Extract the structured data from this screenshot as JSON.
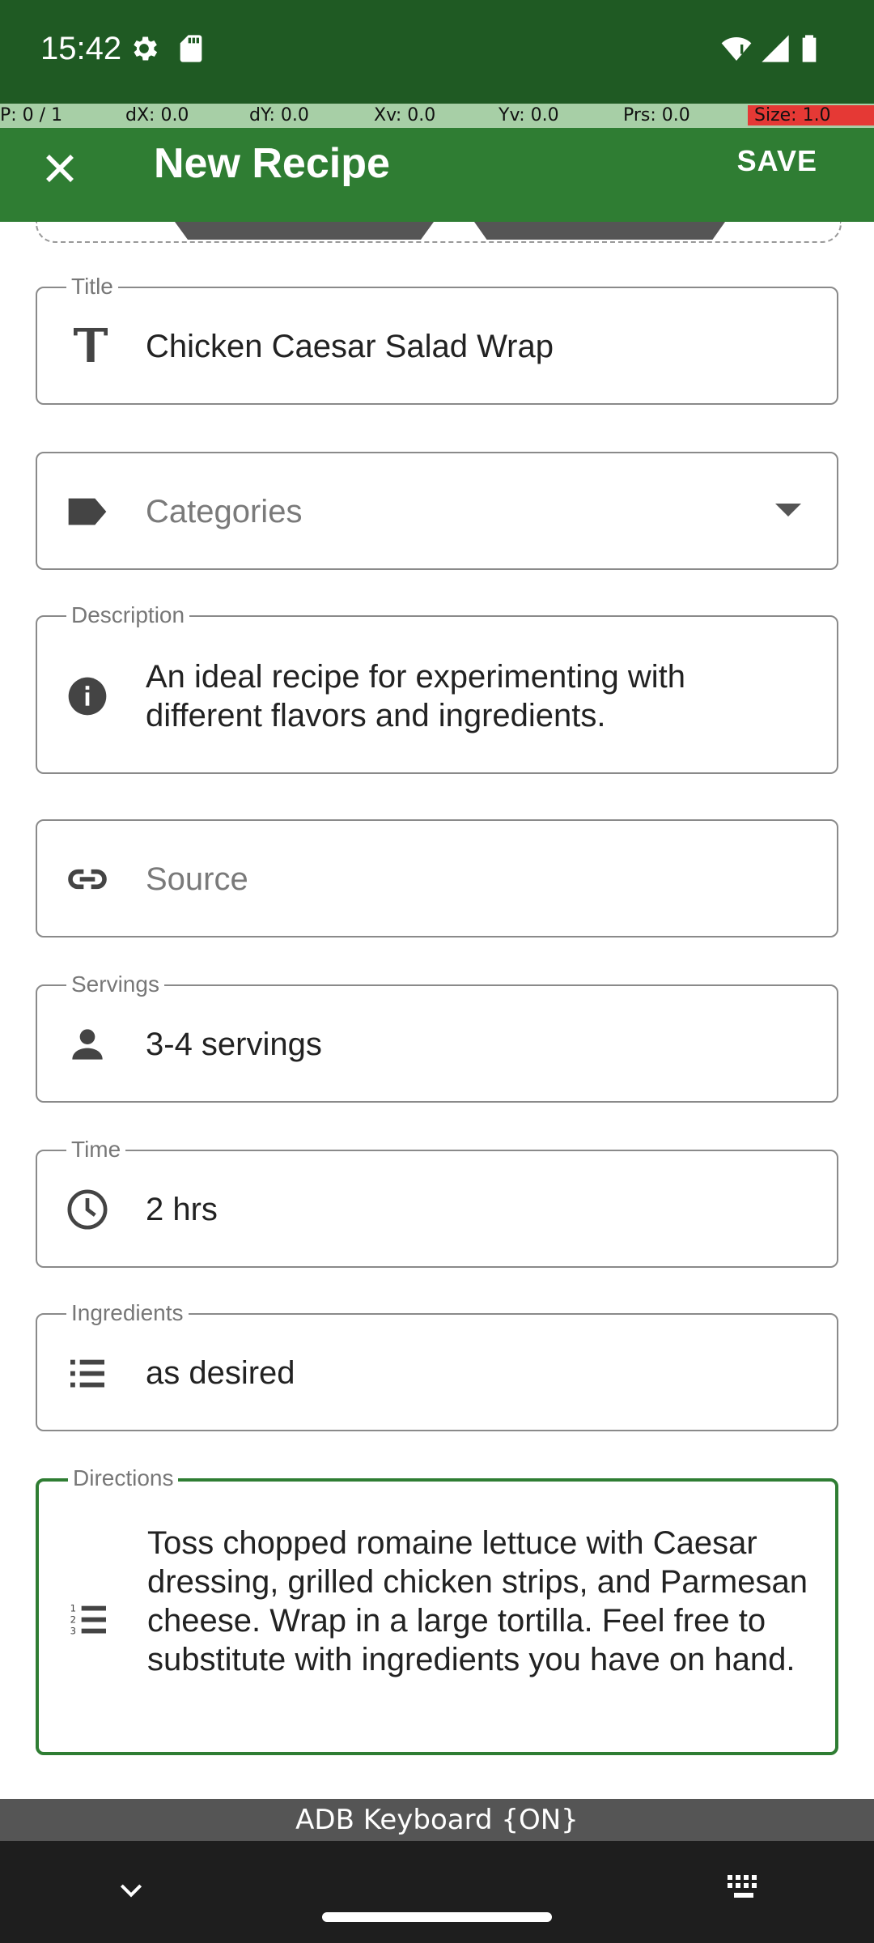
{
  "status_bar": {
    "time": "15:42"
  },
  "debug_bar": {
    "p": "P: 0 / 1",
    "dx": "dX: 0.0",
    "dy": "dY: 0.0",
    "xv": "Xv: 0.0",
    "yv": "Yv: 0.0",
    "prs": "Prs: 0.0",
    "size": "Size: 1.0"
  },
  "app_bar": {
    "title": "New Recipe",
    "save_label": "SAVE"
  },
  "form": {
    "title": {
      "label": "Title",
      "value": "Chicken Caesar Salad Wrap"
    },
    "categories": {
      "placeholder": "Categories"
    },
    "description": {
      "label": "Description",
      "value": "An ideal recipe for experimenting with different flavors and ingredients."
    },
    "source": {
      "placeholder": "Source"
    },
    "servings": {
      "label": "Servings",
      "value": "3-4 servings"
    },
    "time": {
      "label": "Time",
      "value": "2 hrs"
    },
    "ingredients": {
      "label": "Ingredients",
      "value": "as desired"
    },
    "directions": {
      "label": "Directions",
      "value": "Toss chopped romaine lettuce with Caesar dressing, grilled chicken strips, and Parmesan cheese. Wrap in a large tortilla. Feel free to substitute with ingredients you have on hand."
    }
  },
  "keyboard_banner": "ADB Keyboard {ON}",
  "colors": {
    "status_bar": "#1f5a23",
    "app_bar": "#2f7d33",
    "focus_border": "#2f7d33"
  },
  "icons": [
    "settings-icon",
    "sd-card-icon",
    "wifi-icon",
    "signal-icon",
    "battery-icon",
    "close-icon",
    "title-icon",
    "label-icon",
    "info-icon",
    "link-icon",
    "person-icon",
    "clock-icon",
    "list-icon",
    "numbered-list-icon",
    "chevron-down-icon",
    "keyboard-icon"
  ]
}
